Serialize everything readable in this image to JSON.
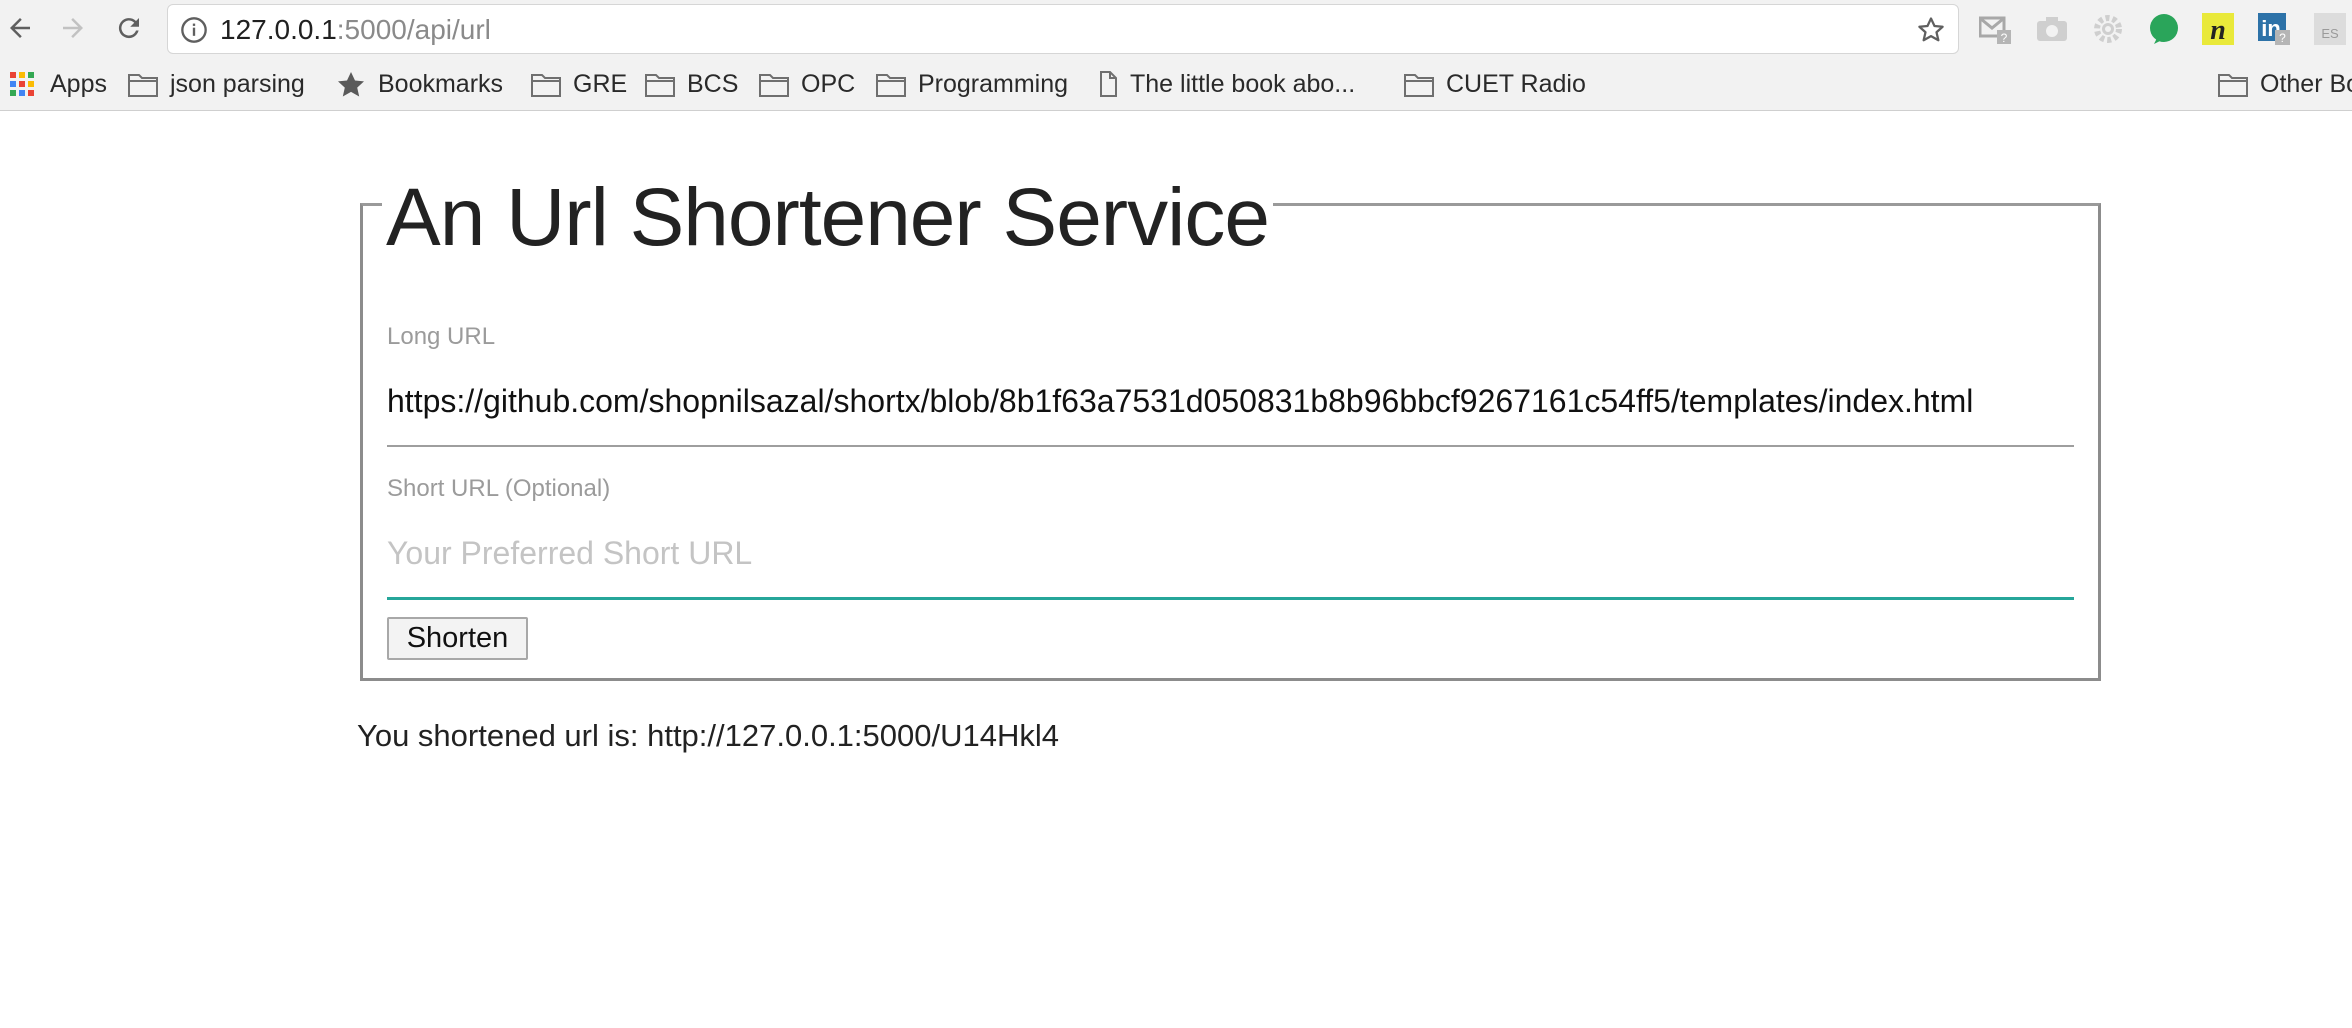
{
  "browser": {
    "url_host": "127.0.0.1",
    "url_rest": ":5000/api/url",
    "bookmarks": [
      {
        "label": "Apps",
        "icon": "apps-grid-icon"
      },
      {
        "label": "json parsing",
        "icon": "folder-icon"
      },
      {
        "label": "Bookmarks",
        "icon": "star-icon"
      },
      {
        "label": "GRE",
        "icon": "folder-icon"
      },
      {
        "label": "BCS",
        "icon": "folder-icon"
      },
      {
        "label": "OPC",
        "icon": "folder-icon"
      },
      {
        "label": "Programming",
        "icon": "folder-icon"
      },
      {
        "label": "The little book abo...",
        "icon": "page-icon"
      },
      {
        "label": "CUET Radio",
        "icon": "folder-icon"
      },
      {
        "label": "Other Bo",
        "icon": "folder-icon"
      }
    ],
    "extensions": [
      "gmail-icon",
      "camera-icon",
      "gear-icon",
      "green-circle-icon",
      "n-extension-icon",
      "linkedin-icon",
      "es-extension-icon"
    ]
  },
  "page": {
    "title": "An Url Shortener Service",
    "long_url": {
      "label": "Long URL",
      "value": "https://github.com/shopnilsazal/shortx/blob/8b1f63a7531d050831b8b96bbcf9267161c54ff5/templates/index.html"
    },
    "short_url": {
      "label": "Short URL (Optional)",
      "placeholder": "Your Preferred Short URL",
      "value": ""
    },
    "button_label": "Shorten",
    "result_text": "You shortened url is: http://127.0.0.1:5000/U14Hkl4"
  },
  "colors": {
    "accent_underline": "#26a69a",
    "inactive_underline": "#9e9e9e"
  }
}
